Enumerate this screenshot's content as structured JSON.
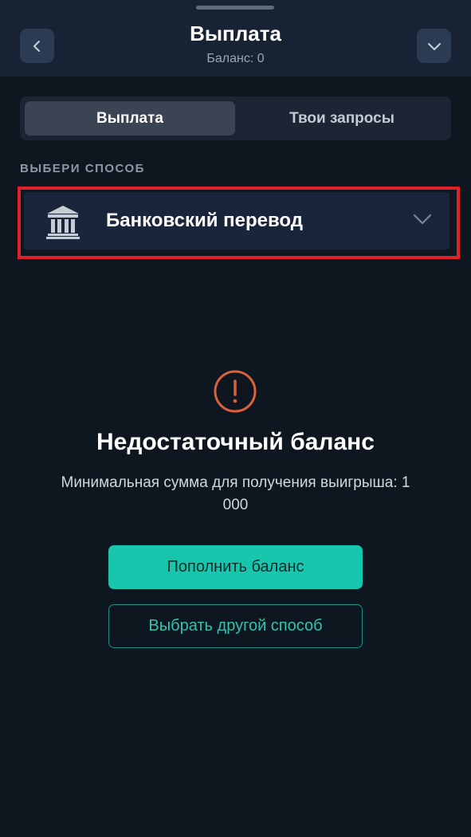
{
  "header": {
    "title": "Выплата",
    "balance": "Баланс: 0",
    "back_icon": "chevron-left-icon",
    "collapse_icon": "chevron-down-icon"
  },
  "tabs": [
    {
      "label": "Выплата",
      "active": true
    },
    {
      "label": "Твои запросы",
      "active": false
    }
  ],
  "method_section": {
    "label": "ВЫБЕРИ СПОСОБ",
    "selected": {
      "label": "Банковский перевод",
      "icon": "bank-icon"
    }
  },
  "empty_state": {
    "icon": "warning-circle-icon",
    "title": "Недостаточный баланс",
    "description": "Минимальная сумма для получения выигрыша: 1 000",
    "primary_button": "Пополнить баланс",
    "secondary_button": "Выбрать другой способ"
  },
  "colors": {
    "accent": "#17c6ad",
    "warning": "#d9623d",
    "highlight": "#e0202a"
  }
}
